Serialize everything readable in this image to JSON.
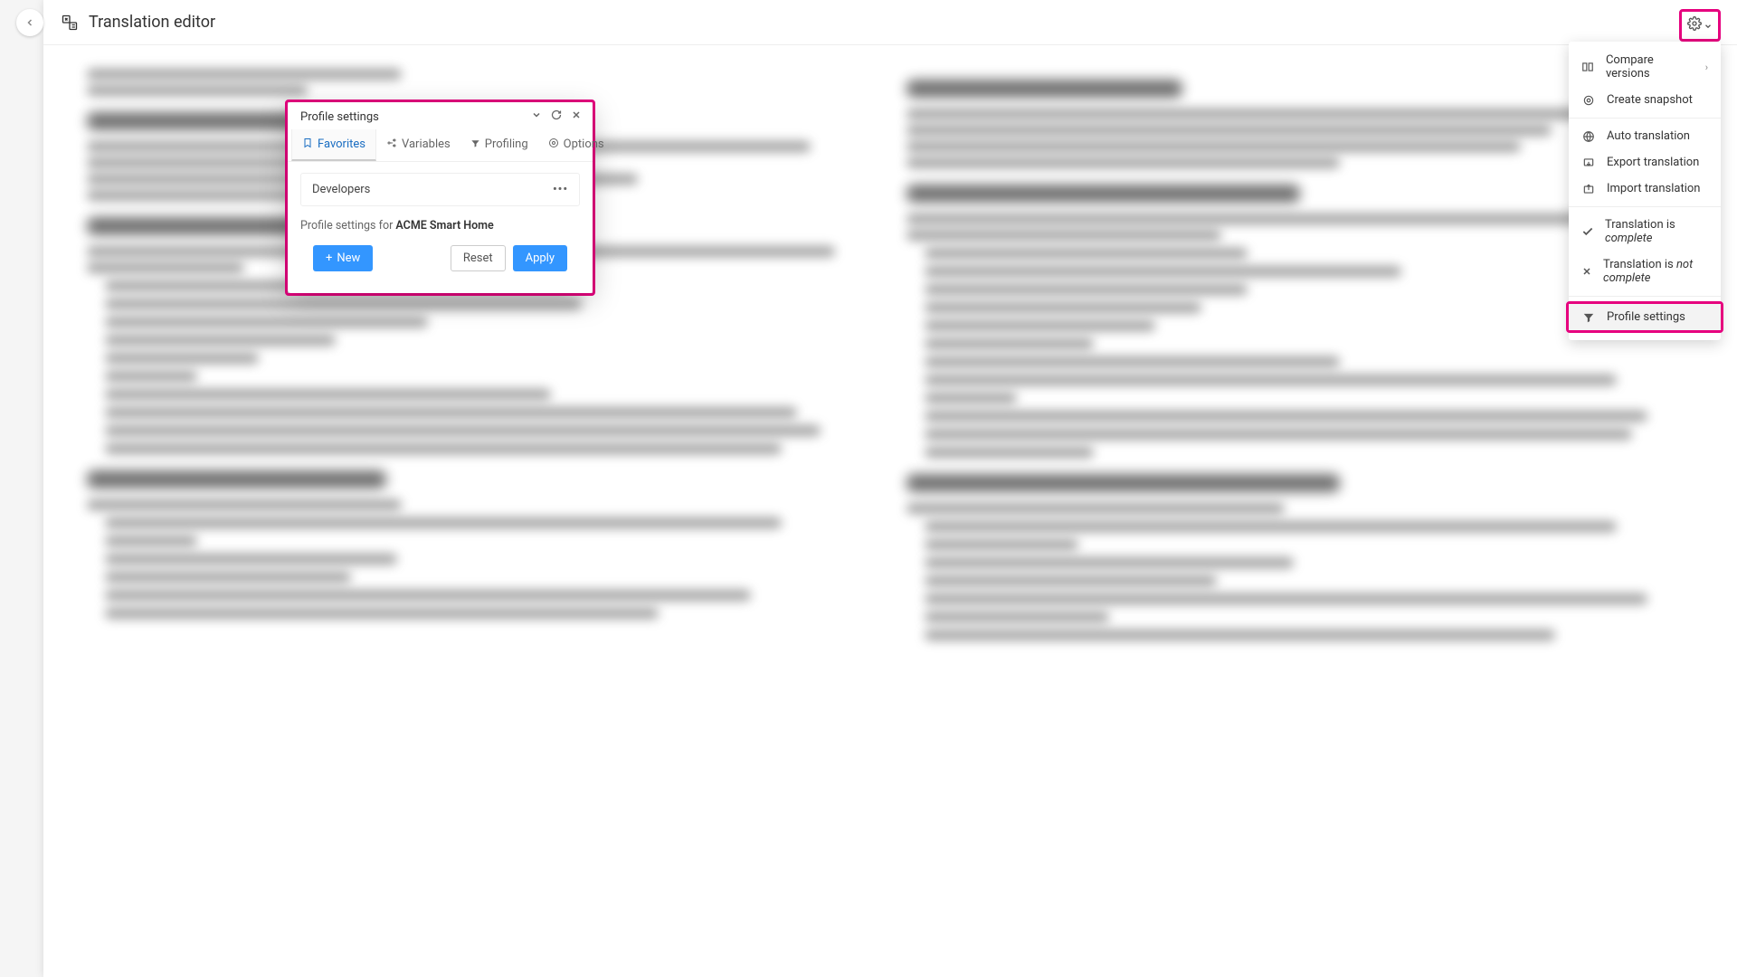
{
  "topbar": {
    "title": "Translation editor"
  },
  "dropdown": {
    "compare": "Compare versions",
    "snapshot": "Create snapshot",
    "auto": "Auto translation",
    "export": "Export translation",
    "import": "Import translation",
    "trans_is_prefix": "Translation is ",
    "complete": "complete",
    "not_complete": "not complete",
    "profile_settings": "Profile settings"
  },
  "modal": {
    "title": "Profile settings",
    "tabs": {
      "favorites": "Favorites",
      "variables": "Variables",
      "profiling": "Profiling",
      "options": "Options"
    },
    "row_label": "Developers",
    "caption_prefix": "Profile settings for ",
    "caption_value": "ACME Smart Home",
    "new": "New",
    "reset": "Reset",
    "apply": "Apply"
  }
}
